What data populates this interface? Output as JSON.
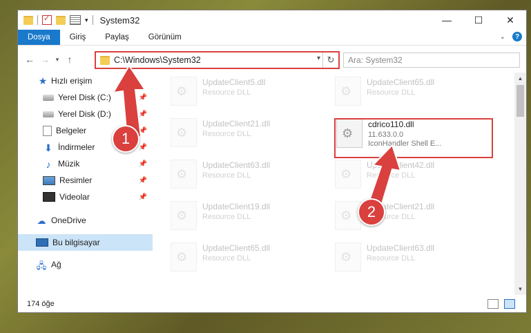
{
  "window": {
    "title": "System32"
  },
  "ribbon": {
    "tabs": [
      "Dosya",
      "Giriş",
      "Paylaş",
      "Görünüm"
    ]
  },
  "address": {
    "path": "C:\\Windows\\System32"
  },
  "search": {
    "placeholder": "Ara: System32"
  },
  "sidebar": {
    "quick_access": "Hızlı erişim",
    "items": [
      "Yerel Disk (C:)",
      "Yerel Disk (D:)",
      "Belgeler",
      "İndirmeler",
      "Müzik",
      "Resimler",
      "Videolar"
    ],
    "onedrive": "OneDrive",
    "this_pc": "Bu bilgisayar",
    "network": "Ağ"
  },
  "files": {
    "left": [
      {
        "name": "UpdateClient5.dll",
        "type": "Resource DLL"
      },
      {
        "name": "UpdateClient21.dll",
        "type": "Resource DLL"
      },
      {
        "name": "UpdateClient63.dll",
        "type": "Resource DLL"
      },
      {
        "name": "UpdateClient19.dll",
        "type": "Resource DLL"
      },
      {
        "name": "UpdateClient65.dll",
        "type": "Resource DLL"
      }
    ],
    "right": [
      {
        "name": "UpdateClient65.dll",
        "type": "Resource DLL"
      },
      {
        "name": "UpdateClient42.dll",
        "type": "Resource DLL"
      },
      {
        "name": "UpdateClient21.dll",
        "type": "Resource DLL"
      },
      {
        "name": "UpdateClient63.dll",
        "type": "Resource DLL"
      }
    ],
    "highlighted": {
      "name": "cdrico110.dll",
      "version": "11.633.0.0",
      "description": "IconHandler Shell E..."
    }
  },
  "annotations": {
    "badge1": "1",
    "badge2": "2"
  },
  "status": {
    "count": "174 öğe"
  },
  "colors": {
    "accent": "#1979ca",
    "highlight": "#d9403e"
  }
}
